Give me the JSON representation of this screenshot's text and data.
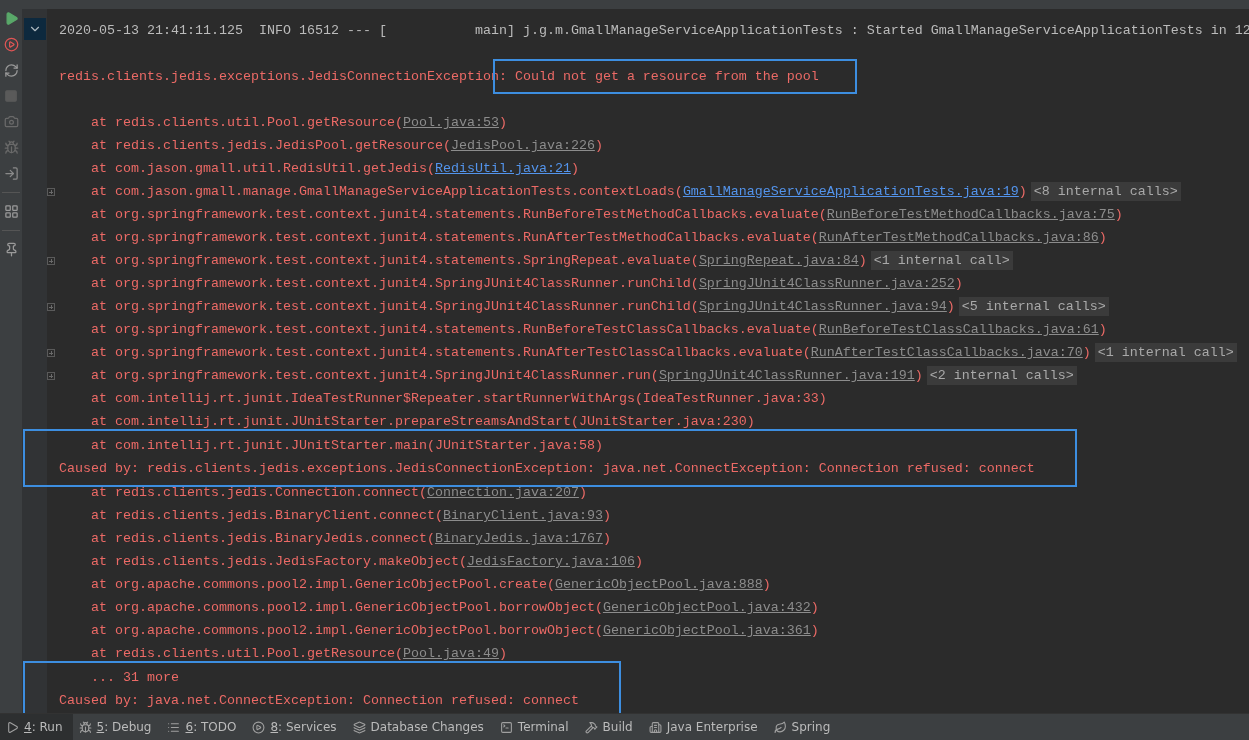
{
  "console": {
    "blocks": [
      {
        "boxed": false,
        "lines": [
          {
            "kind": "log",
            "segments": [
              {
                "kind": "text",
                "text": "2020-05-13 21:41:11.125  INFO 16512 --- [           main] j.g.m.GmallManageServiceApplicationTests : Started GmallManageServiceApplicationTests in 12"
              }
            ]
          },
          {
            "kind": "exception",
            "segments": [
              {
                "kind": "text",
                "text": "redis.clients.jedis.exceptions.JedisConnectionException"
              },
              {
                "kind": "highlight",
                "text": ": Could not get a resource from the pool"
              }
            ]
          },
          {
            "kind": "frame",
            "foldable": false,
            "segments": [
              {
                "kind": "text",
                "text": "at redis.clients.util.Pool.getResource("
              },
              {
                "kind": "link",
                "text": "Pool.java:53"
              },
              {
                "kind": "text",
                "text": ")"
              }
            ]
          },
          {
            "kind": "frame",
            "foldable": false,
            "segments": [
              {
                "kind": "text",
                "text": "at redis.clients.jedis.JedisPool.getResource("
              },
              {
                "kind": "link",
                "text": "JedisPool.java:226"
              },
              {
                "kind": "text",
                "text": ")"
              }
            ]
          },
          {
            "kind": "frame",
            "foldable": false,
            "segments": [
              {
                "kind": "text",
                "text": "at com.jason.gmall.util.RedisUtil.getJedis("
              },
              {
                "kind": "project_link",
                "text": "RedisUtil.java:21"
              },
              {
                "kind": "text",
                "text": ")"
              }
            ]
          },
          {
            "kind": "frame",
            "foldable": true,
            "segments": [
              {
                "kind": "text",
                "text": "at com.jason.gmall.manage.GmallManageServiceApplicationTests.contextLoads("
              },
              {
                "kind": "project_link",
                "text": "GmallManageServiceApplicationTests.java:19"
              },
              {
                "kind": "text",
                "text": ")"
              },
              {
                "kind": "internal",
                "text": "<8 internal calls>"
              }
            ]
          },
          {
            "kind": "frame",
            "foldable": false,
            "segments": [
              {
                "kind": "text",
                "text": "at org.springframework.test.context.junit4.statements.RunBeforeTestMethodCallbacks.evaluate("
              },
              {
                "kind": "link",
                "text": "RunBeforeTestMethodCallbacks.java:75"
              },
              {
                "kind": "text",
                "text": ")"
              }
            ]
          },
          {
            "kind": "frame",
            "foldable": false,
            "segments": [
              {
                "kind": "text",
                "text": "at org.springframework.test.context.junit4.statements.RunAfterTestMethodCallbacks.evaluate("
              },
              {
                "kind": "link",
                "text": "RunAfterTestMethodCallbacks.java:86"
              },
              {
                "kind": "text",
                "text": ")"
              }
            ]
          },
          {
            "kind": "frame",
            "foldable": true,
            "segments": [
              {
                "kind": "text",
                "text": "at org.springframework.test.context.junit4.statements.SpringRepeat.evaluate("
              },
              {
                "kind": "link",
                "text": "SpringRepeat.java:84"
              },
              {
                "kind": "text",
                "text": ")"
              },
              {
                "kind": "internal",
                "text": "<1 internal call>"
              }
            ]
          },
          {
            "kind": "frame",
            "foldable": false,
            "segments": [
              {
                "kind": "text",
                "text": "at org.springframework.test.context.junit4.SpringJUnit4ClassRunner.runChild("
              },
              {
                "kind": "link",
                "text": "SpringJUnit4ClassRunner.java:252"
              },
              {
                "kind": "text",
                "text": ")"
              }
            ]
          },
          {
            "kind": "frame",
            "foldable": true,
            "segments": [
              {
                "kind": "text",
                "text": "at org.springframework.test.context.junit4.SpringJUnit4ClassRunner.runChild("
              },
              {
                "kind": "link",
                "text": "SpringJUnit4ClassRunner.java:94"
              },
              {
                "kind": "text",
                "text": ")"
              },
              {
                "kind": "internal",
                "text": "<5 internal calls>"
              }
            ]
          },
          {
            "kind": "frame",
            "foldable": false,
            "segments": [
              {
                "kind": "text",
                "text": "at org.springframework.test.context.junit4.statements.RunBeforeTestClassCallbacks.evaluate("
              },
              {
                "kind": "link",
                "text": "RunBeforeTestClassCallbacks.java:61"
              },
              {
                "kind": "text",
                "text": ")"
              }
            ]
          },
          {
            "kind": "frame",
            "foldable": true,
            "segments": [
              {
                "kind": "text",
                "text": "at org.springframework.test.context.junit4.statements.RunAfterTestClassCallbacks.evaluate("
              },
              {
                "kind": "link",
                "text": "RunAfterTestClassCallbacks.java:70"
              },
              {
                "kind": "text",
                "text": ")"
              },
              {
                "kind": "internal",
                "text": "<1 internal call>"
              }
            ]
          },
          {
            "kind": "frame",
            "foldable": true,
            "segments": [
              {
                "kind": "text",
                "text": "at org.springframework.test.context.junit4.SpringJUnit4ClassRunner.run("
              },
              {
                "kind": "link",
                "text": "SpringJUnit4ClassRunner.java:191"
              },
              {
                "kind": "text",
                "text": ")"
              },
              {
                "kind": "internal",
                "text": "<2 internal calls>"
              }
            ]
          },
          {
            "kind": "frame",
            "foldable": false,
            "segments": [
              {
                "kind": "text",
                "text": "at com.intellij.rt.junit.IdeaTestRunner$Repeater.startRunnerWithArgs(IdeaTestRunner.java:33)"
              }
            ]
          },
          {
            "kind": "frame",
            "foldable": false,
            "segments": [
              {
                "kind": "text",
                "text": "at com.intellij.rt.junit.JUnitStarter.prepareStreamsAndStart(JUnitStarter.java:230)"
              }
            ]
          }
        ]
      },
      {
        "boxed": true,
        "lines": [
          {
            "kind": "frame",
            "foldable": false,
            "segments": [
              {
                "kind": "text",
                "text": "at com.intellij.rt.junit.JUnitStarter.main(JUnitStarter.java:58)"
              }
            ]
          },
          {
            "kind": "caused",
            "segments": [
              {
                "kind": "text",
                "text": "Caused by: redis.clients.jedis.exceptions.JedisConnectionException: java.net.ConnectException: Connection refused: connect"
              }
            ]
          }
        ]
      },
      {
        "boxed": false,
        "lines": [
          {
            "kind": "frame",
            "foldable": false,
            "segments": [
              {
                "kind": "text",
                "text": "at redis.clients.jedis.Connection.connect("
              },
              {
                "kind": "link",
                "text": "Connection.java:207"
              },
              {
                "kind": "text",
                "text": ")"
              }
            ]
          },
          {
            "kind": "frame",
            "foldable": false,
            "segments": [
              {
                "kind": "text",
                "text": "at redis.clients.jedis.BinaryClient.connect("
              },
              {
                "kind": "link",
                "text": "BinaryClient.java:93"
              },
              {
                "kind": "text",
                "text": ")"
              }
            ]
          },
          {
            "kind": "frame",
            "foldable": false,
            "segments": [
              {
                "kind": "text",
                "text": "at redis.clients.jedis.BinaryJedis.connect("
              },
              {
                "kind": "link",
                "text": "BinaryJedis.java:1767"
              },
              {
                "kind": "text",
                "text": ")"
              }
            ]
          },
          {
            "kind": "frame",
            "foldable": false,
            "segments": [
              {
                "kind": "text",
                "text": "at redis.clients.jedis.JedisFactory.makeObject("
              },
              {
                "kind": "link",
                "text": "JedisFactory.java:106"
              },
              {
                "kind": "text",
                "text": ")"
              }
            ]
          },
          {
            "kind": "frame",
            "foldable": false,
            "segments": [
              {
                "kind": "text",
                "text": "at org.apache.commons.pool2.impl.GenericObjectPool.create("
              },
              {
                "kind": "link",
                "text": "GenericObjectPool.java:888"
              },
              {
                "kind": "text",
                "text": ")"
              }
            ]
          },
          {
            "kind": "frame",
            "foldable": false,
            "segments": [
              {
                "kind": "text",
                "text": "at org.apache.commons.pool2.impl.GenericObjectPool.borrowObject("
              },
              {
                "kind": "link",
                "text": "GenericObjectPool.java:432"
              },
              {
                "kind": "text",
                "text": ")"
              }
            ]
          },
          {
            "kind": "frame",
            "foldable": false,
            "segments": [
              {
                "kind": "text",
                "text": "at org.apache.commons.pool2.impl.GenericObjectPool.borrowObject("
              },
              {
                "kind": "link",
                "text": "GenericObjectPool.java:361"
              },
              {
                "kind": "text",
                "text": ")"
              }
            ]
          },
          {
            "kind": "frame",
            "foldable": false,
            "segments": [
              {
                "kind": "text",
                "text": "at redis.clients.util.Pool.getResource("
              },
              {
                "kind": "link",
                "text": "Pool.java:49"
              },
              {
                "kind": "text",
                "text": ")"
              }
            ]
          }
        ]
      },
      {
        "boxed": true,
        "lines": [
          {
            "kind": "more",
            "segments": [
              {
                "kind": "text",
                "text": "... 31 more"
              }
            ]
          },
          {
            "kind": "caused",
            "segments": [
              {
                "kind": "text",
                "text": "Caused by: java.net.ConnectException: Connection refused: connect"
              }
            ]
          }
        ]
      }
    ]
  },
  "tool_tabs": [
    {
      "kind": "run",
      "mnemonic": "4",
      "label": ": Run",
      "selected": true
    },
    {
      "kind": "debug",
      "mnemonic": "5",
      "label": ": Debug",
      "selected": false
    },
    {
      "kind": "todo",
      "mnemonic": "6",
      "label": ": TODO",
      "selected": false
    },
    {
      "kind": "services",
      "mnemonic": "8",
      "label": ": Services",
      "selected": false
    },
    {
      "kind": "database",
      "label": "Database Changes",
      "selected": false
    },
    {
      "kind": "terminal",
      "label": "Terminal",
      "selected": false
    },
    {
      "kind": "build",
      "label": "Build",
      "selected": false
    },
    {
      "kind": "enterprise",
      "label": "Java Enterprise",
      "selected": false
    },
    {
      "kind": "spring",
      "label": "Spring",
      "selected": false
    }
  ]
}
